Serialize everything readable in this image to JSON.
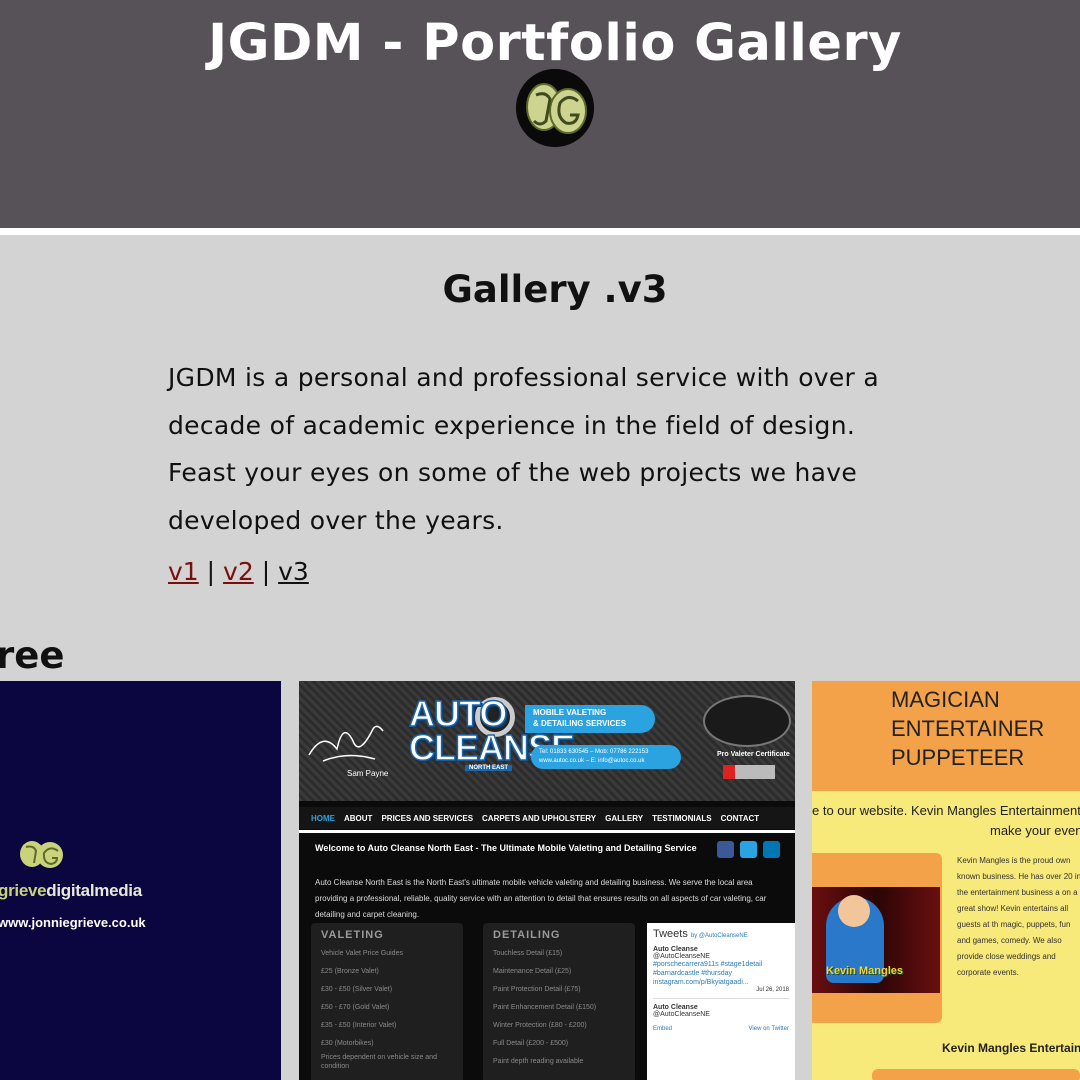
{
  "header": {
    "title": "JGDM - Portfolio Gallery",
    "logo_icon": "jg-logo-icon",
    "background_color": "#575258"
  },
  "main": {
    "heading": "Gallery .v3",
    "intro": "JGDM is a personal and professional service with over a decade of academic experience in the field of design. Feast your eyes on some of the web projects we have developed over the years.",
    "versions": [
      {
        "label": "v1",
        "state": "visited"
      },
      {
        "label": "v2",
        "state": "visited"
      },
      {
        "label": "v3",
        "state": "current"
      }
    ],
    "separator": "|",
    "section_title": "ree",
    "link_visited_color": "#7a0f0f",
    "background_color": "#d3d3d3"
  },
  "thumbnails": [
    {
      "brand_prefix": "grieve",
      "brand_suffix": "digitalmedia",
      "url": "www.jonniegrieve.co.uk",
      "background_color": "#0b0540"
    },
    {
      "logo_word_1": "AUTO",
      "logo_word_2": "CLEANSE",
      "logo_tag": "NORTH EAST",
      "signature_name": "Sam Payne",
      "pill_line_1": "MOBILE VALETING",
      "pill_line_2": "& DETAILING SERVICES",
      "contact_line_1": "Tel: 01833 630545 – Mob: 07786 222153",
      "contact_line_2": "www.autoc.co.uk – E: info@autoc.co.uk",
      "badge_label": "Pro Valeter Certificate",
      "nav": [
        "HOME",
        "ABOUT",
        "PRICES AND SERVICES",
        "CARPETS AND UPHOLSTERY",
        "GALLERY",
        "TESTIMONIALS",
        "CONTACT"
      ],
      "welcome": "Welcome to Auto Cleanse North East - The Ultimate Mobile Valeting and Detailing Service",
      "body": "Auto Cleanse North East is the North East's ultimate mobile vehicle valeting and detailing business. We serve the local area providing a professional, reliable, quality service with an attention to detail that ensures results on all aspects of car valeting, car detailing and carpet cleaning.",
      "valeting_title": "VALETING",
      "valeting_items": [
        "Vehicle Valet Price Guides",
        "£25 (Bronze Valet)",
        "£30 - £50 (Silver Valet)",
        "£50 - £70 (Gold Valet)",
        "£35 - £50 (Interior Valet)",
        "£30 (Motorbikes)",
        "Prices dependent on vehicle size and condition"
      ],
      "detailing_title": "DETAILING",
      "detailing_items": [
        "Touchless Detail (£15)",
        "Maintenance Detail (£25)",
        "Paint Protection Detail (£75)",
        "Paint Enhancement Detail (£150)",
        "Winter Protection (£80 - £200)",
        "Full Detail (£200 - £500)",
        "Paint depth reading available"
      ],
      "tweets_title": "Tweets",
      "tweets_by": "by @AutoCleanseNE",
      "tweet_name": "Auto Cleanse",
      "tweet_handle": "@AutoCleanseNE",
      "tweet_text": "#porschecarrera911s #stage1detail #barnardcastle #thursday instagram.com/p/Bkyiatgaadi...",
      "tweet_date": "Jul 26, 2018",
      "tweet_embed": "Embed",
      "tweet_view": "View on Twitter"
    },
    {
      "title_lines": [
        "MAGICIAN",
        "ENTERTAINER",
        "PUPPETEER"
      ],
      "welcome_line_1": "e to our website. Kevin Mangles Entertainment",
      "welcome_line_2": "make your event",
      "text": "Kevin Mangles is the proud own known business. He has over 20 in the entertainment business a on a great show! Kevin entertains all guests at th magic, puppets, fun and games, comedy. We also provide close weddings and corporate events.",
      "character_logo": "Kevin Mangles",
      "footer": "Kevin Mangles Entertain"
    }
  ]
}
